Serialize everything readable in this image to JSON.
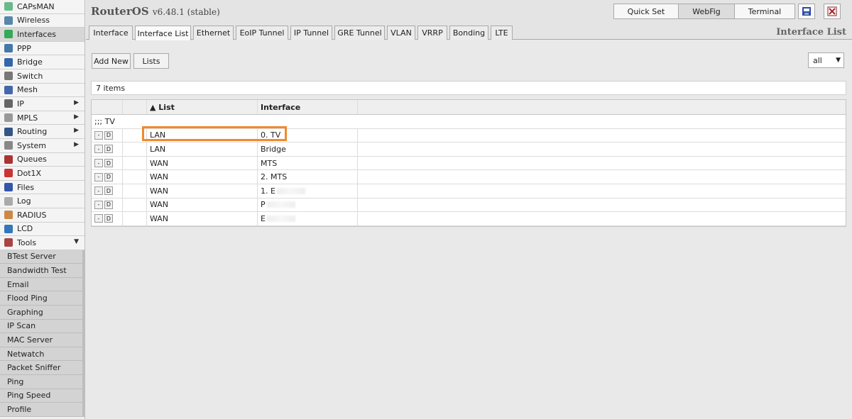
{
  "sidebar": {
    "items": [
      {
        "label": "CAPsMAN",
        "icon": "capsman-icon",
        "arrow": ""
      },
      {
        "label": "Wireless",
        "icon": "wireless-icon",
        "arrow": ""
      },
      {
        "label": "Interfaces",
        "icon": "interfaces-icon",
        "arrow": "",
        "active": true
      },
      {
        "label": "PPP",
        "icon": "ppp-icon",
        "arrow": ""
      },
      {
        "label": "Bridge",
        "icon": "bridge-icon",
        "arrow": ""
      },
      {
        "label": "Switch",
        "icon": "switch-icon",
        "arrow": ""
      },
      {
        "label": "Mesh",
        "icon": "mesh-icon",
        "arrow": ""
      },
      {
        "label": "IP",
        "icon": "ip-icon",
        "arrow": "▶"
      },
      {
        "label": "MPLS",
        "icon": "mpls-icon",
        "arrow": "▶"
      },
      {
        "label": "Routing",
        "icon": "routing-icon",
        "arrow": "▶"
      },
      {
        "label": "System",
        "icon": "system-icon",
        "arrow": "▶"
      },
      {
        "label": "Queues",
        "icon": "queues-icon",
        "arrow": ""
      },
      {
        "label": "Dot1X",
        "icon": "dot1x-icon",
        "arrow": ""
      },
      {
        "label": "Files",
        "icon": "files-icon",
        "arrow": ""
      },
      {
        "label": "Log",
        "icon": "log-icon",
        "arrow": ""
      },
      {
        "label": "RADIUS",
        "icon": "radius-icon",
        "arrow": ""
      },
      {
        "label": "LCD",
        "icon": "lcd-icon",
        "arrow": ""
      },
      {
        "label": "Tools",
        "icon": "tools-icon",
        "arrow": "▼"
      }
    ],
    "tools_sub": [
      "BTest Server",
      "Bandwidth Test",
      "Email",
      "Flood Ping",
      "Graphing",
      "IP Scan",
      "MAC Server",
      "Netwatch",
      "Packet Sniffer",
      "Ping",
      "Ping Speed",
      "Profile"
    ]
  },
  "header": {
    "brand": "RouterOS",
    "version": "v6.48.1 (stable)",
    "buttons": {
      "quick_set": "Quick Set",
      "webfig": "WebFig",
      "terminal": "Terminal"
    }
  },
  "tabs": [
    "Interface",
    "Interface List",
    "Ethernet",
    "EoIP Tunnel",
    "IP Tunnel",
    "GRE Tunnel",
    "VLAN",
    "VRRP",
    "Bonding",
    "LTE"
  ],
  "active_tab": "Interface List",
  "page_title": "Interface List",
  "toolbar": {
    "add_new": "Add New",
    "lists": "Lists",
    "filter_value": "all"
  },
  "item_count": "7 items",
  "table": {
    "headers": {
      "list": "▲ List",
      "interface": "Interface"
    },
    "comment": ";;; TV",
    "row_buttons": {
      "remove": "-",
      "disable": "D"
    },
    "rows": [
      {
        "list": "LAN",
        "interface": "0. TV",
        "blurred": false
      },
      {
        "list": "LAN",
        "interface": "Bridge",
        "blurred": false
      },
      {
        "list": "WAN",
        "interface": "MTS",
        "blurred": false
      },
      {
        "list": "WAN",
        "interface": "2. MTS",
        "blurred": false
      },
      {
        "list": "WAN",
        "interface": "1. E",
        "blurred": true
      },
      {
        "list": "WAN",
        "interface": "P",
        "blurred": true
      },
      {
        "list": "WAN",
        "interface": "E",
        "blurred": true
      }
    ]
  },
  "colors": {
    "highlight": "#f08a2c",
    "sidebar_active": "#d7d7d7"
  }
}
